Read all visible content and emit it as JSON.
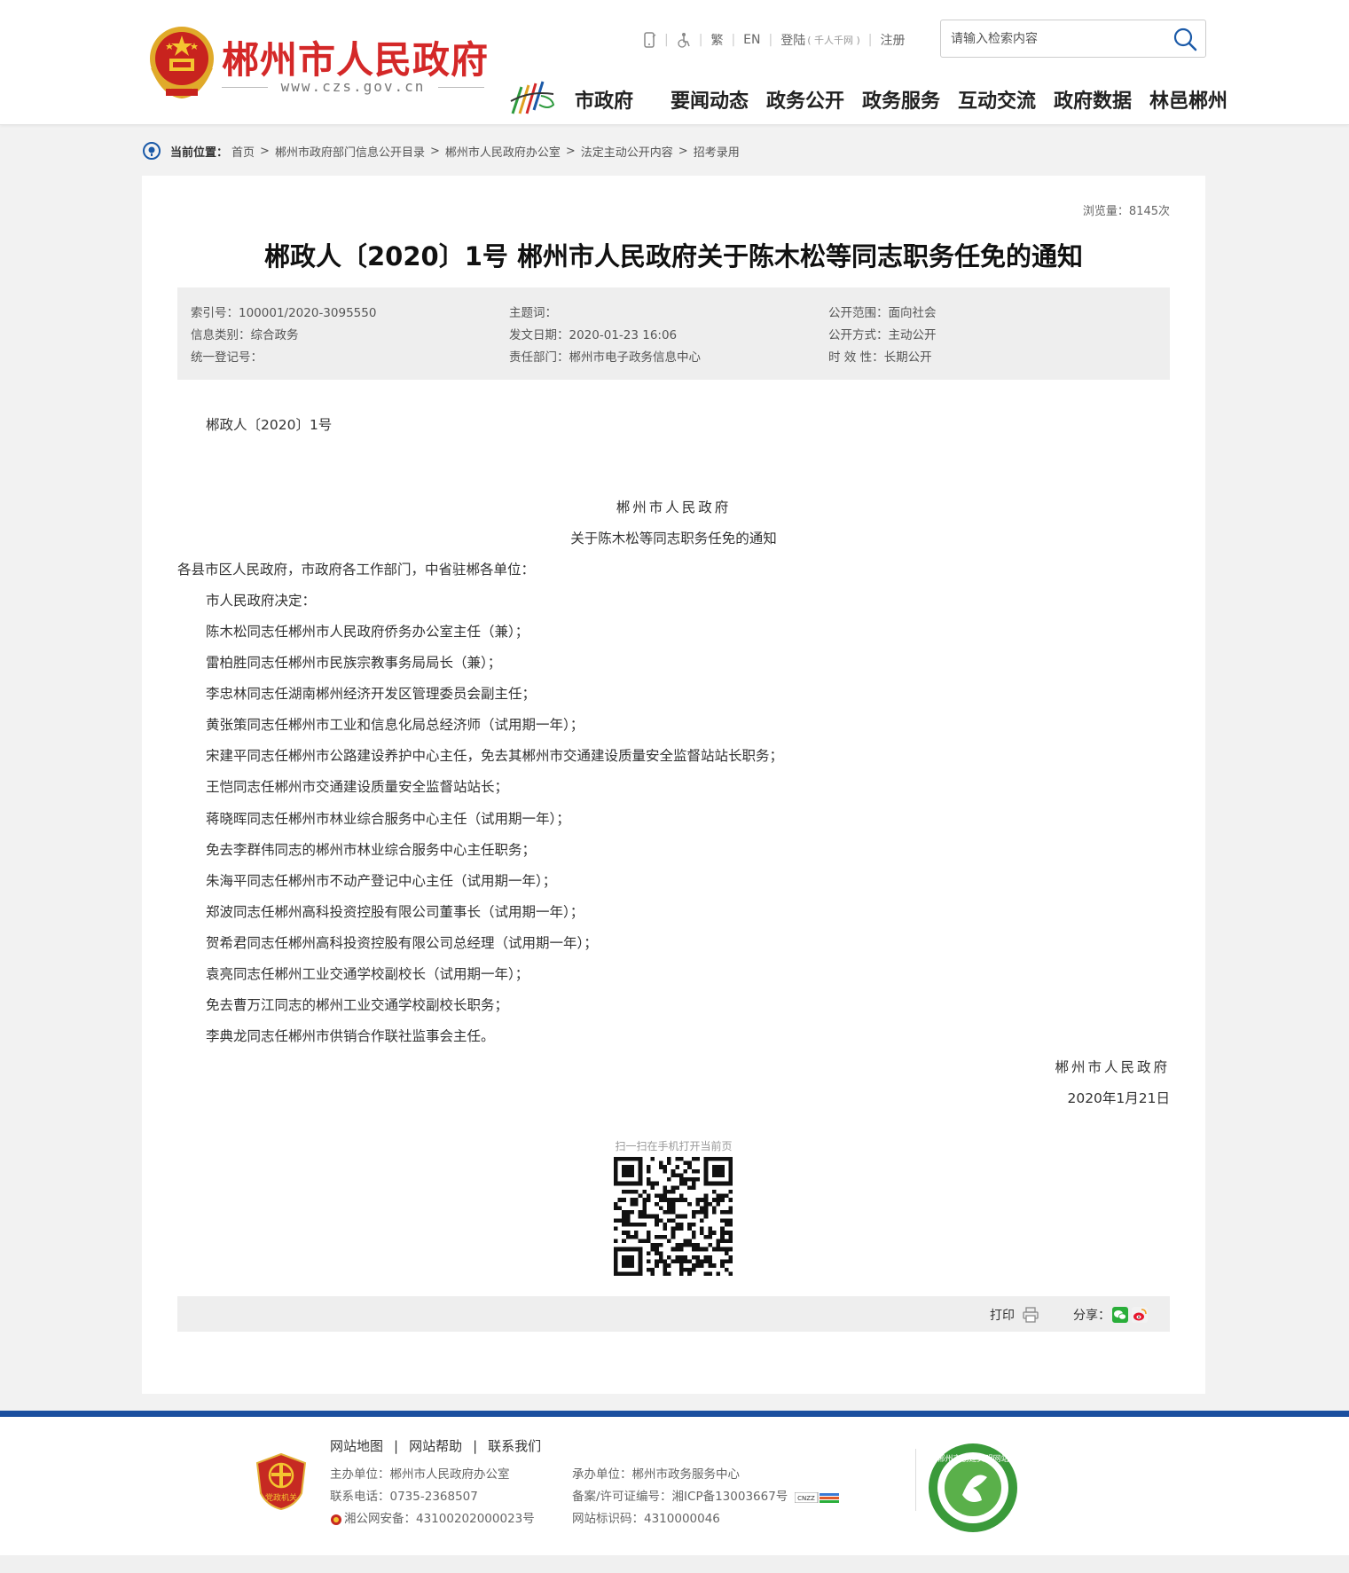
{
  "header": {
    "site_name": "郴州市人民政府",
    "domain": "www.czs.gov.cn",
    "topbar": {
      "lang_trad": "繁",
      "lang_en": "EN",
      "login": "登陆",
      "login_note": "( 千人千网 )",
      "register": "注册"
    },
    "search": {
      "placeholder": "请输入检索内容"
    },
    "nav": [
      "市政府",
      "要闻动态",
      "政务公开",
      "政务服务",
      "互动交流",
      "政府数据",
      "林邑郴州"
    ]
  },
  "breadcrumb": {
    "label": "当前位置：",
    "items": [
      "首页",
      "郴州市政府部门信息公开目录",
      "郴州市人民政府办公室",
      "法定主动公开内容",
      "招考录用"
    ]
  },
  "article": {
    "views": "浏览量：8145次",
    "title": "郴政人〔2020〕1号 郴州市人民政府关于陈木松等同志职务任免的通知",
    "meta": {
      "col1": [
        "索引号：100001/2020-3095550",
        "信息类别：综合政务",
        "统一登记号："
      ],
      "col2": [
        "主题词：",
        "发文日期：2020-01-23 16:06",
        "责任部门：郴州市电子政务信息中心"
      ],
      "col3": [
        "公开范围：面向社会",
        "公开方式：主动公开",
        "时 效 性：长期公开"
      ]
    },
    "doc_no": "郴政人〔2020〕1号",
    "issuer": "郴州市人民政府",
    "doc_title": "关于陈木松等同志职务任免的通知",
    "salutation": "各县市区人民政府，市政府各工作部门，中省驻郴各单位：",
    "decision": "市人民政府决定：",
    "items": [
      "陈木松同志任郴州市人民政府侨务办公室主任（兼）；",
      "雷柏胜同志任郴州市民族宗教事务局局长（兼）；",
      "李忠林同志任湖南郴州经济开发区管理委员会副主任；",
      "黄张策同志任郴州市工业和信息化局总经济师（试用期一年）；",
      "宋建平同志任郴州市公路建设养护中心主任，免去其郴州市交通建设质量安全监督站站长职务；",
      "王恺同志任郴州市交通建设质量安全监督站站长；",
      "蒋晓晖同志任郴州市林业综合服务中心主任（试用期一年）；",
      "免去李群伟同志的郴州市林业综合服务中心主任职务；",
      "朱海平同志任郴州市不动产登记中心主任（试用期一年）；",
      "郑波同志任郴州高科投资控股有限公司董事长（试用期一年）；",
      "贺希君同志任郴州高科投资控股有限公司总经理（试用期一年）；",
      "袁亮同志任郴州工业交通学校副校长（试用期一年）；",
      "免去曹万江同志的郴州工业交通学校副校长职务；",
      "李典龙同志任郴州市供销合作联社监事会主任。"
    ],
    "sign": "郴州市人民政府",
    "date": "2020年1月21日",
    "qr_caption": "扫一扫在手机打开当前页",
    "print": "打印",
    "share": "分享："
  },
  "footer": {
    "links": [
      "网站地图",
      "网站帮助",
      "联系我们"
    ],
    "left": [
      "主办单位：郴州市人民政府办公室",
      "联系电话：0735-2368507",
      "湘公网安备：43100202000023号"
    ],
    "right": [
      "承办单位：郴州市政务服务中心",
      "备案/许可证编号：湘ICP备13003667号",
      "网站标识码：4310000046"
    ],
    "badge_left": "党政机关",
    "badge_right": "郴州市创建文明网站"
  },
  "colors": {
    "brand_red": "#d42828",
    "footer_blue": "#1b4f9f",
    "meta_bg": "#eeeeee"
  }
}
